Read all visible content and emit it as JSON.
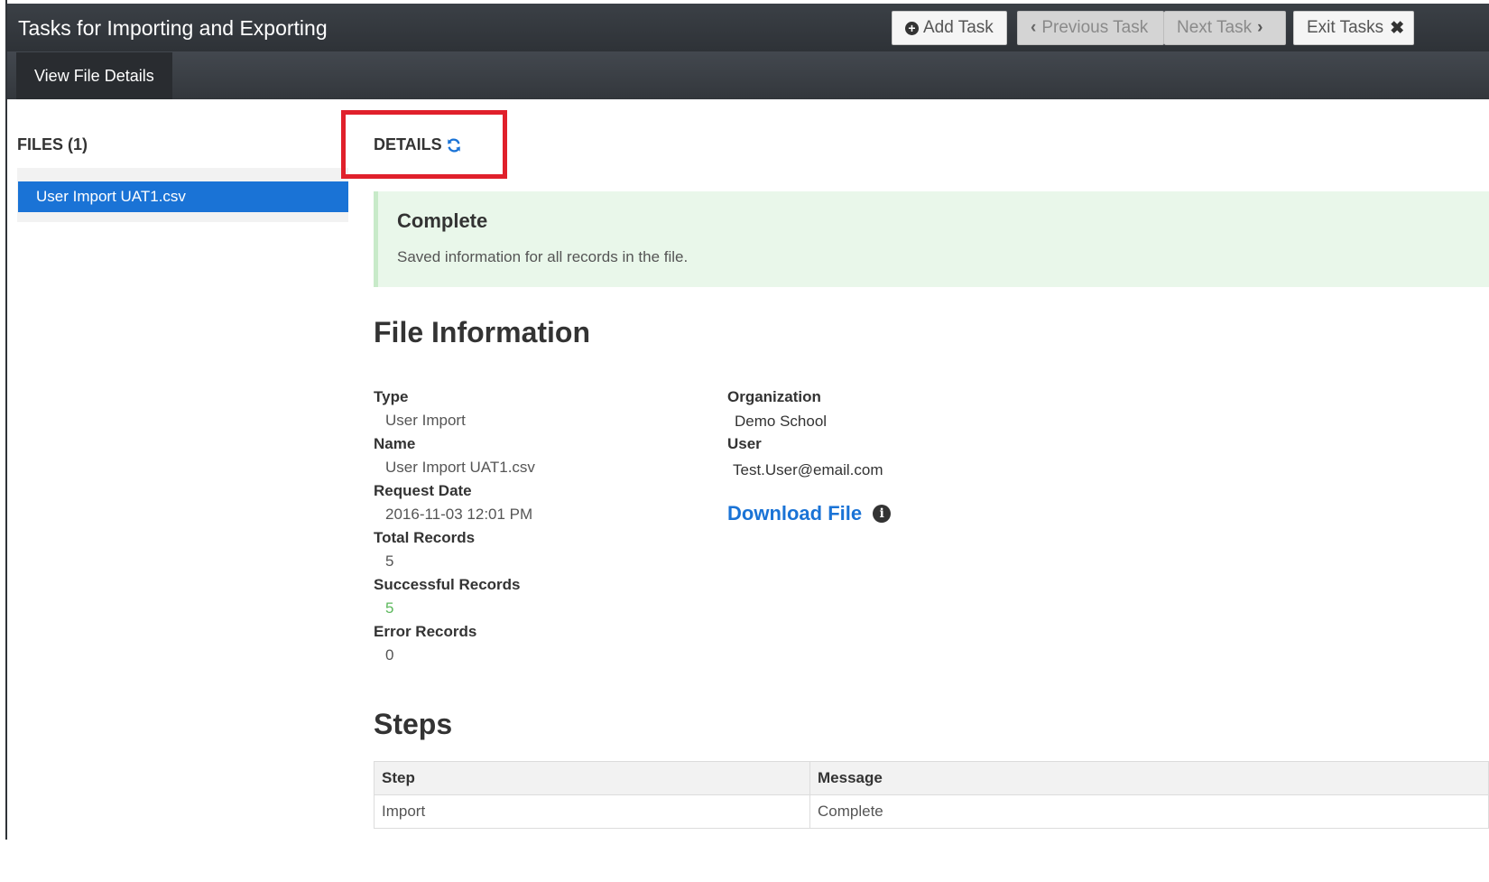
{
  "header": {
    "title": "Tasks for Importing and Exporting",
    "buttons": {
      "add_task": "Add Task",
      "previous_task": "Previous Task",
      "next_task": "Next Task",
      "exit_tasks": "Exit Tasks"
    }
  },
  "subnav": {
    "active_tab": "View File Details"
  },
  "files": {
    "heading": "FILES (1)",
    "items": [
      {
        "label": "User Import UAT1.csv",
        "selected": true
      }
    ]
  },
  "details": {
    "heading": "DETAILS",
    "status": {
      "title": "Complete",
      "message": "Saved information for all records in the file."
    },
    "file_information": {
      "title": "File Information",
      "type_label": "Type",
      "type_value": "User Import",
      "name_label": "Name",
      "name_value": "User Import UAT1.csv",
      "request_date_label": "Request Date",
      "request_date_value": "2016-11-03 12:01 PM",
      "total_records_label": "Total Records",
      "total_records_value": "5",
      "successful_records_label": "Successful Records",
      "successful_records_value": "5",
      "error_records_label": "Error Records",
      "error_records_value": "0",
      "organization_label": "Organization",
      "organization_value": "Demo School",
      "user_label": "User",
      "user_value": "Test.User@email.com",
      "download_label": "Download File"
    },
    "steps": {
      "title": "Steps",
      "columns": [
        "Step",
        "Message"
      ],
      "rows": [
        [
          "Import",
          "Complete"
        ]
      ]
    }
  },
  "colors": {
    "topbar": "#33373c",
    "selected_item": "#1a73d6",
    "link": "#1a73d6",
    "success_bg": "#e9f7ea",
    "highlight_border": "#e0202b",
    "success_value": "#5cb85c"
  }
}
